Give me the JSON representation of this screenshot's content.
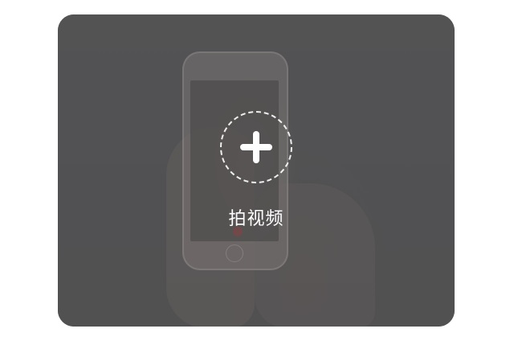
{
  "upload_card": {
    "action_label": "拍视频",
    "icon": "plus-icon",
    "accent_color": "#ffffff"
  }
}
